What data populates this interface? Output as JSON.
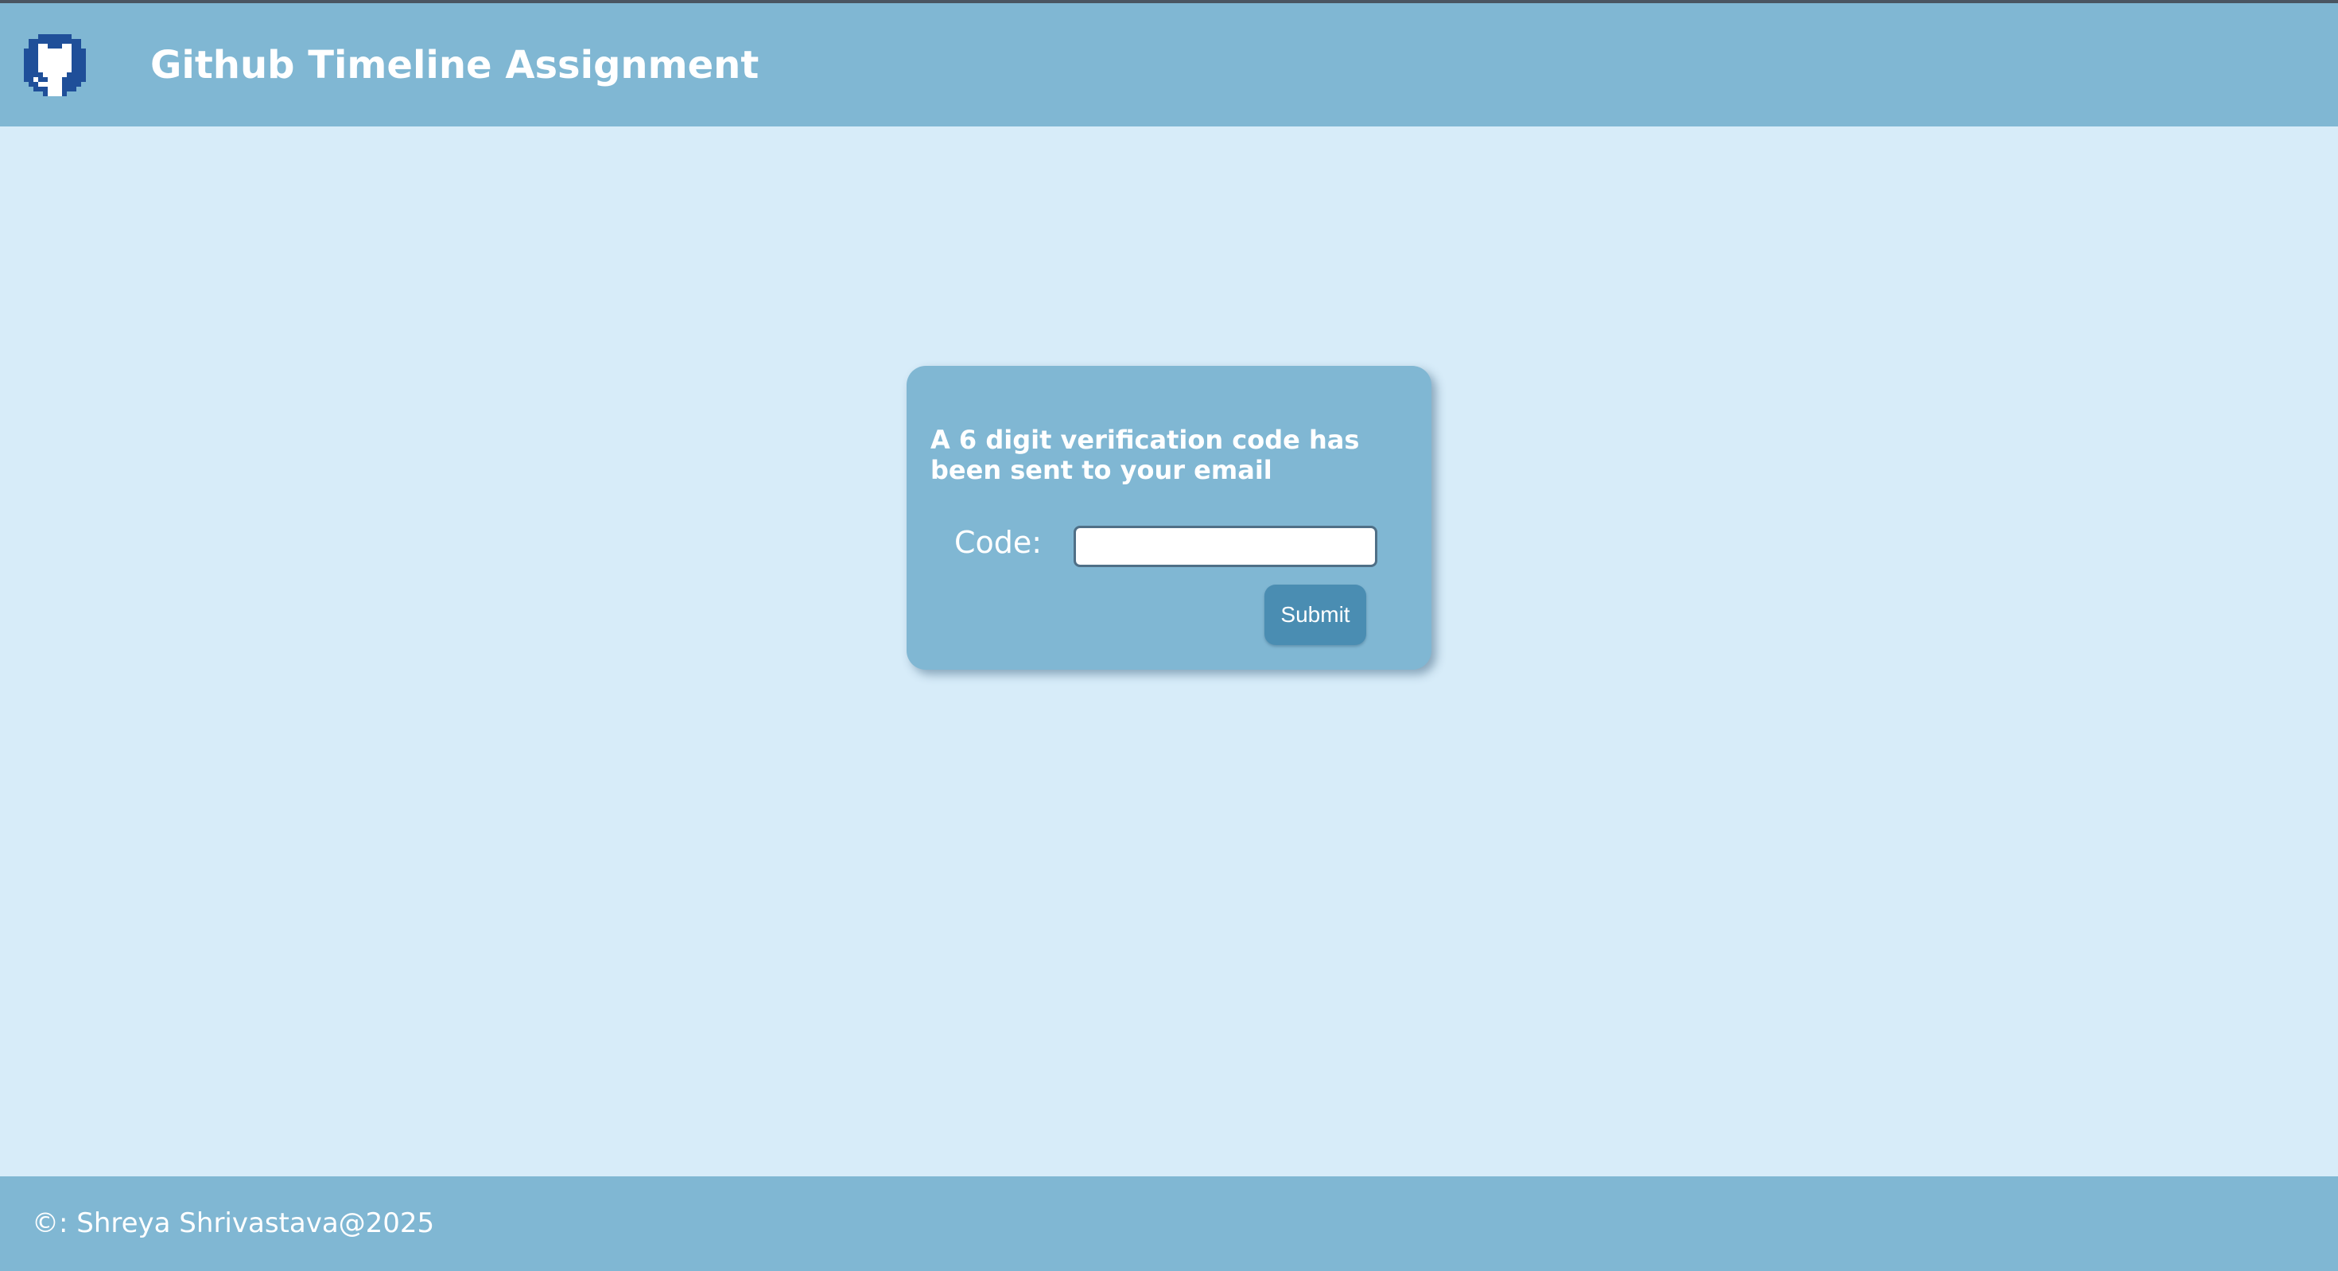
{
  "header": {
    "logo_icon": "github-octocat-icon",
    "title": "Github Timeline Assignment"
  },
  "verification": {
    "message": "A 6 digit verification code has been sent to your email",
    "code_label": "Code:",
    "code_value": "",
    "code_placeholder": "",
    "submit_label": "Submit"
  },
  "footer": {
    "copyright": "©: Shreya Shrivastava@2025"
  },
  "colors": {
    "header_bg": "#80b7d3",
    "page_bg": "#d7ecf9",
    "card_bg": "#80b7d3",
    "button_bg": "#4a8db2",
    "logo_blue": "#1f4f99"
  }
}
